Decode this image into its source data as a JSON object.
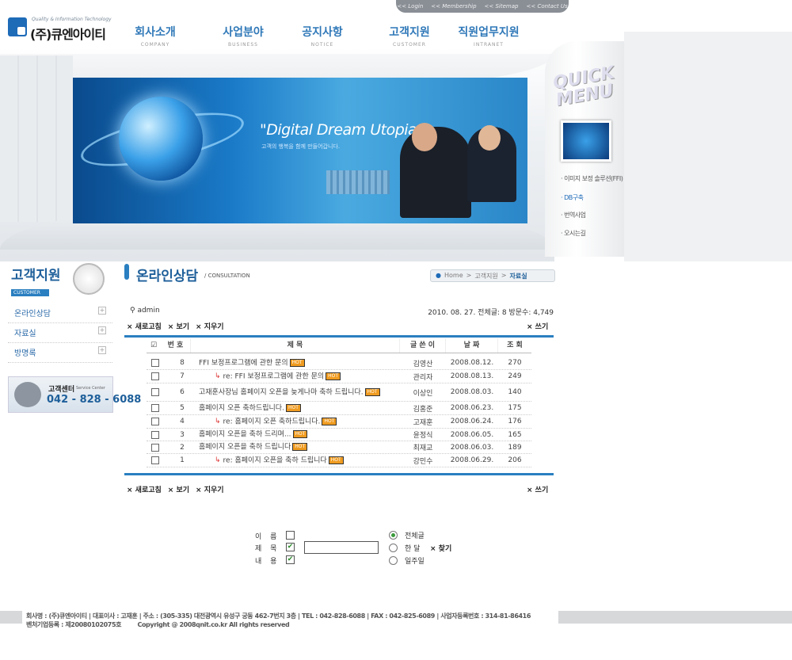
{
  "util_links": [
    "<< Login",
    "<< Membership",
    "<< Sitemap",
    "<< Contact Us"
  ],
  "logo": {
    "tagline": "Quality & Information Technology",
    "name": "(주)큐엔아이티"
  },
  "nav": [
    {
      "ko": "회사소개",
      "en": "COMPANY"
    },
    {
      "ko": "사업분야",
      "en": "BUSINESS"
    },
    {
      "ko": "공지사항",
      "en": "NOTICE"
    },
    {
      "ko": "고객지원",
      "en": "CUSTOMER"
    },
    {
      "ko": "직원업무지원",
      "en": "INTRANET"
    }
  ],
  "banner": {
    "slogan": "\"Digital Dream Utopia!\"",
    "sub": "고객의 행복을 함께 만들어갑니다."
  },
  "quick": {
    "title_line1": "QUICK",
    "title_line2": "MENU",
    "items": [
      "· 이미지 보정 솔루션(FFI)",
      "· DB구축",
      "· 번역사업",
      "· 오시는길"
    ]
  },
  "left": {
    "title": "고객지원",
    "sub": "CUSTOMER",
    "items": [
      "온라인상담",
      "자료실",
      "방명록"
    ],
    "service_label": "고객센터",
    "service_en": "Service Center",
    "service_phone": "042 - 828 - 6088"
  },
  "content": {
    "title": "온라인상담",
    "title_en": "/  CONSULTATION",
    "crumb_home": "Home",
    "crumb_mid": "고객지원",
    "crumb_cur": "자료실",
    "admin": "admin",
    "stats": "2010. 08. 27.  전체글: 8  방문수: 4,749",
    "btn_refresh": "× 새로고침",
    "btn_view": "× 보기",
    "btn_delete": "× 지우기",
    "btn_write": "× 쓰기"
  },
  "table": {
    "headers": [
      "번 호",
      "제      목",
      "글 쓴 이",
      "날 짜",
      "조 회"
    ],
    "rows": [
      {
        "num": "8",
        "title": "FFI 보정프로그램에 관한 문의",
        "reply": false,
        "author": "김영산",
        "date": "2008.08.12.",
        "views": "270"
      },
      {
        "num": "7",
        "title": "re: FFI 보정프로그램에 관한 문의",
        "reply": true,
        "author": "관리자",
        "date": "2008.08.13.",
        "views": "249"
      },
      {
        "num": "6",
        "title": "고재훈사장님 홈페이지 오픈을 늦게나마 축하 드립니다.",
        "reply": false,
        "author": "이상인",
        "date": "2008.08.03.",
        "views": "140"
      },
      {
        "num": "5",
        "title": "홈페이지 오픈 축하드립니다.",
        "reply": false,
        "author": "김홍준",
        "date": "2008.06.23.",
        "views": "175"
      },
      {
        "num": "4",
        "title": "re: 홈페이지 오픈 축하드립니다.",
        "reply": true,
        "author": "고재훈",
        "date": "2008.06.24.",
        "views": "176"
      },
      {
        "num": "3",
        "title": "홈페이지 오픈을 축하 드리며...",
        "reply": false,
        "author": "윤정식",
        "date": "2008.06.05.",
        "views": "165"
      },
      {
        "num": "2",
        "title": "홈페이지 오픈을 축하 드립니다",
        "reply": false,
        "author": "최재교",
        "date": "2008.06.03.",
        "views": "189"
      },
      {
        "num": "1",
        "title": "re: 홈페이지 오픈을 축하 드립니다",
        "reply": true,
        "author": "강민수",
        "date": "2008.06.29.",
        "views": "206"
      }
    ],
    "hot_label": "HOT"
  },
  "search": {
    "field_name": "이 름",
    "field_subject": "제 목",
    "field_content": "내 용",
    "opt_all": "전체글",
    "opt_month": "한  달",
    "opt_week": "일주일",
    "button": "× 찾기",
    "query": ""
  },
  "footer": {
    "line1": "회사명 : (주)큐엔아이티  |  대표이사 : 고재훈  |  주소 : (305-335) 대전광역시 유성구 궁동 462-7번지 3층  |  TEL : 042-828-6088  |  FAX : 042-825-6089  |  사업자등록번호 : 314-81-86416",
    "line2_a": "벤처기업등록 : 제20080102075호",
    "line2_b": "Copyright @ 2008qnit.co.kr All rights reserved"
  }
}
